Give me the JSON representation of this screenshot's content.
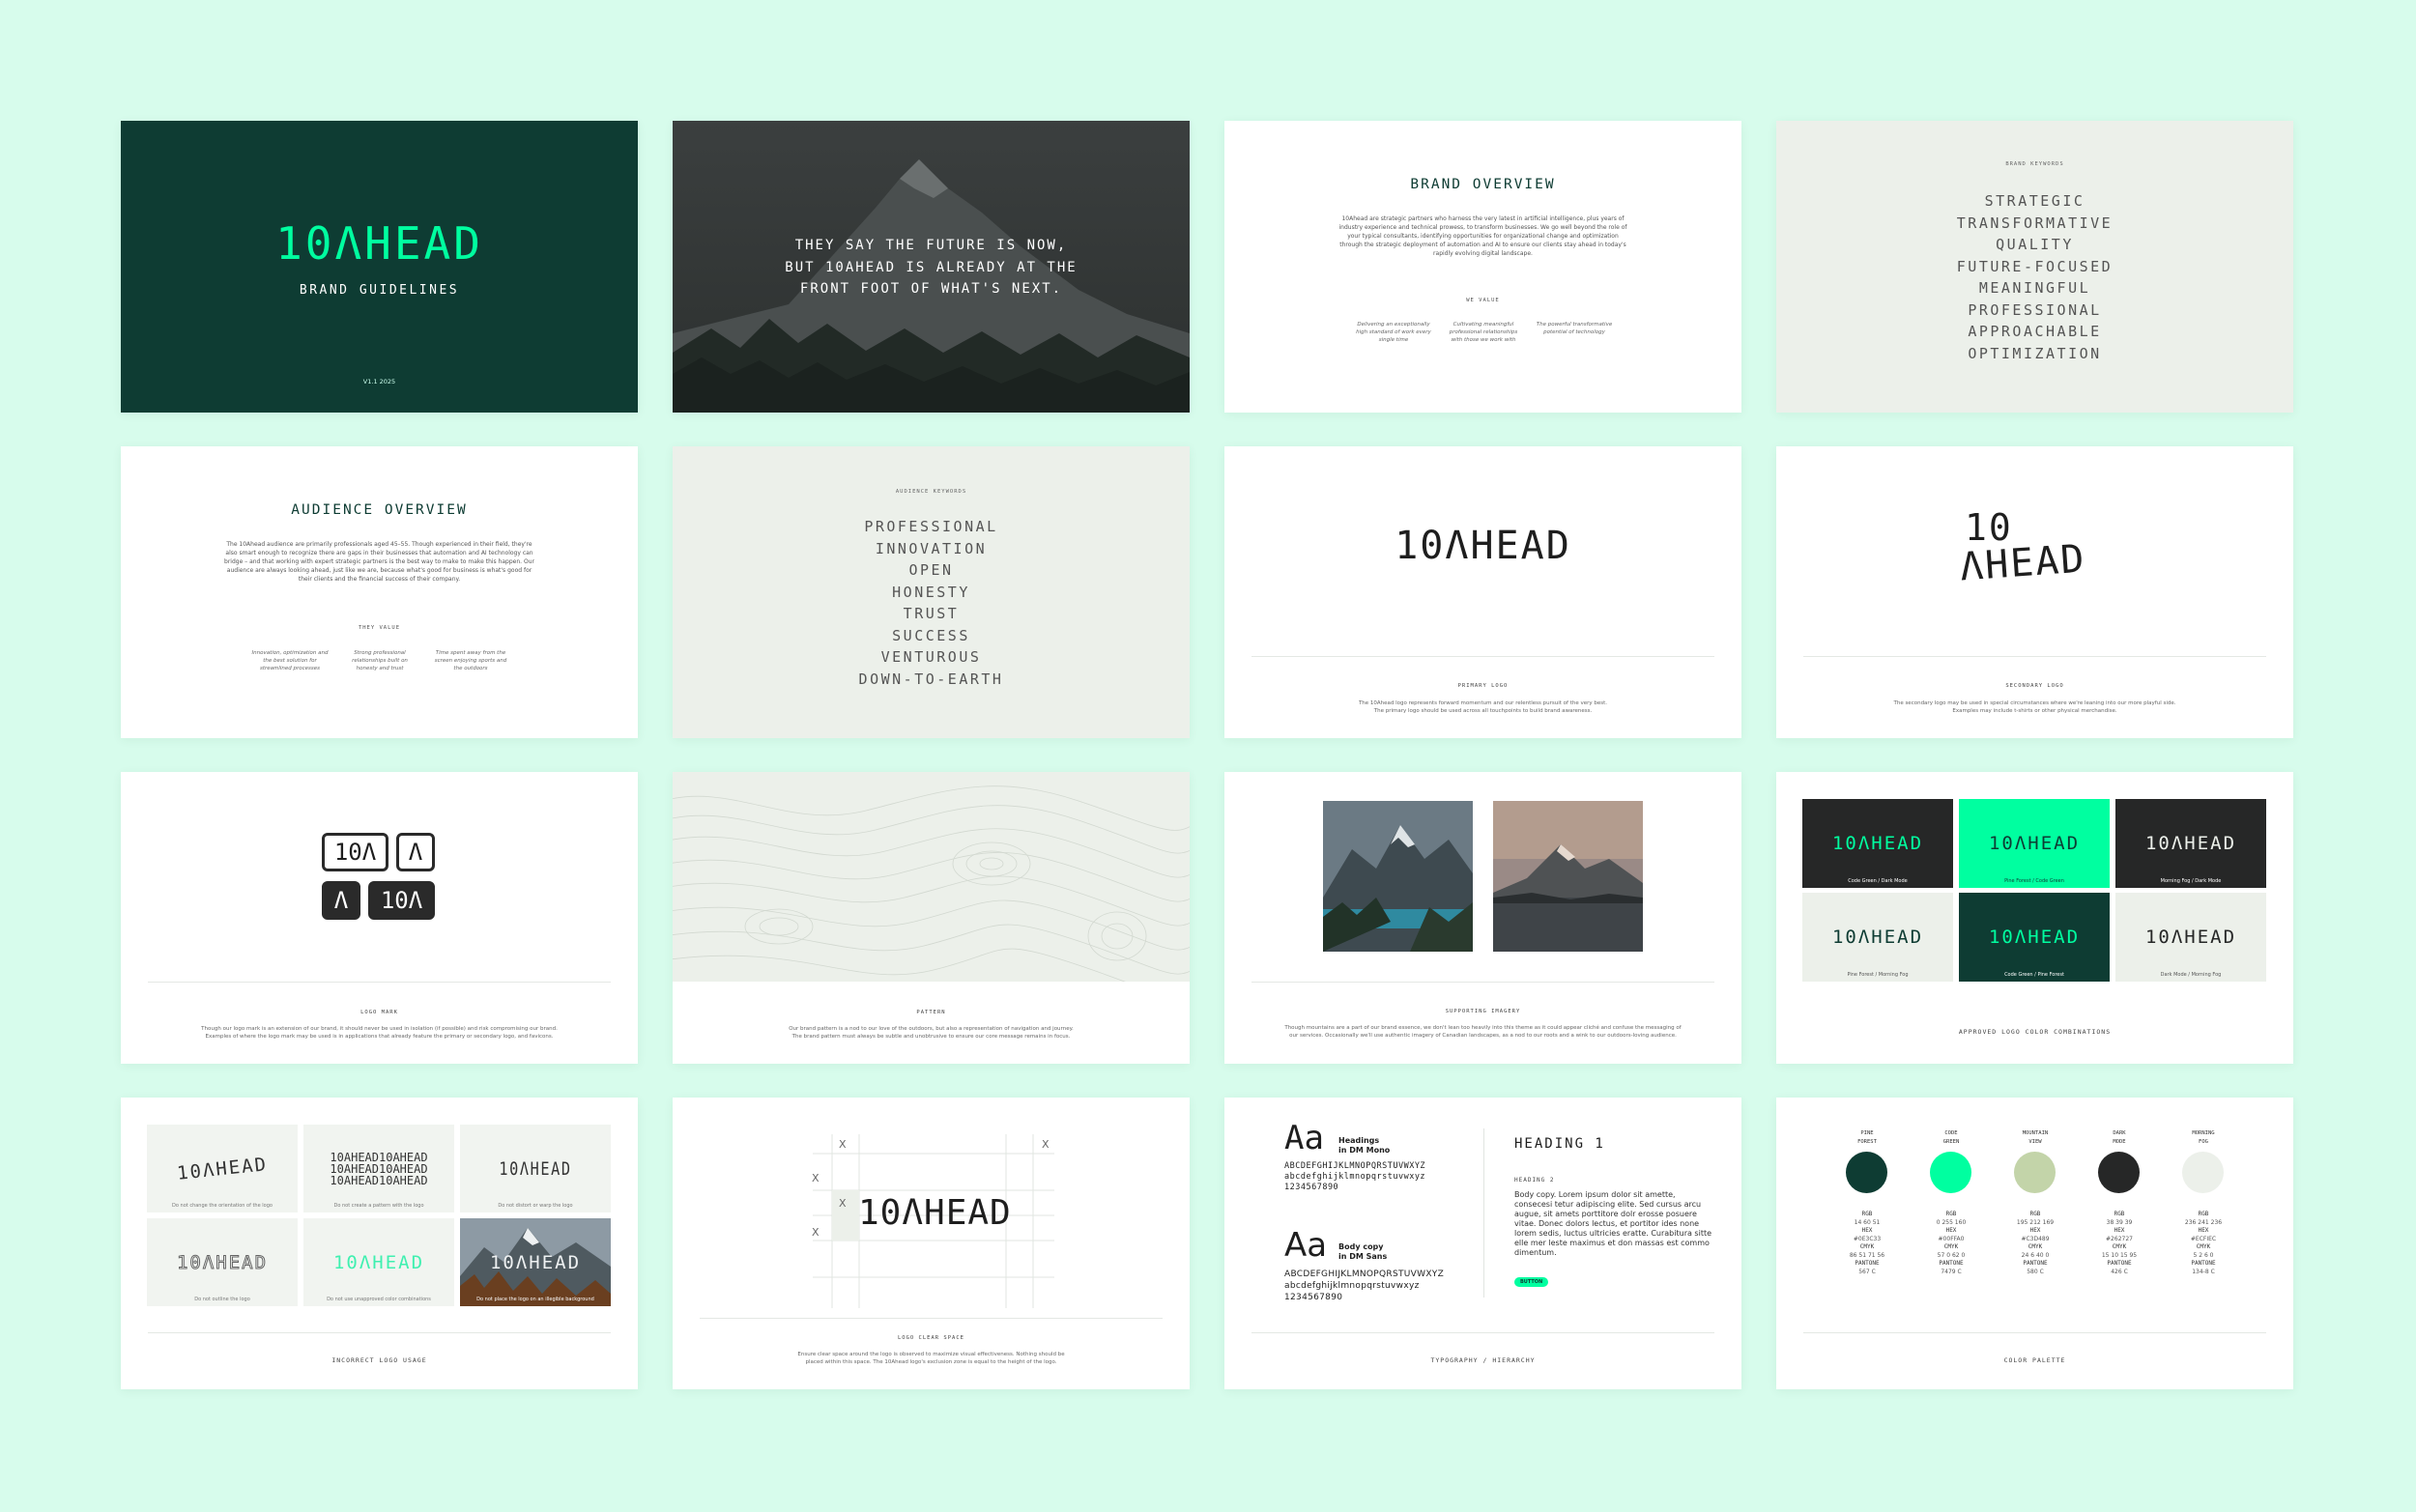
{
  "brand": {
    "logo": "10ΛHEAD",
    "logo_split_top": "10",
    "logo_split_bottom": "ΛHEAD"
  },
  "colors": {
    "page_bg": "#d7fcec",
    "pine_forest": "#0E3C33",
    "code_green": "#00FFA0",
    "mountain_view": "#C3D489",
    "dark_mode": "#262727",
    "morning_fog": "#ECF0EA"
  },
  "slides": {
    "cover": {
      "title": "BRAND GUIDELINES",
      "version": "V1.1 2025"
    },
    "quote": {
      "lines": [
        "THEY SAY THE FUTURE IS NOW,",
        "BUT 10AHEAD IS ALREADY AT THE",
        "FRONT FOOT OF WHAT'S NEXT."
      ]
    },
    "brand_overview": {
      "title": "BRAND OVERVIEW",
      "body": "10Ahead are strategic partners who harness the very latest in artificial intelligence, plus years of industry experience and technical prowess, to transform businesses. We go well beyond the role of your typical consultants, identifying opportunities for organizational change and optimization through the strategic deployment of automation and AI to ensure our clients stay ahead in today's rapidly evolving digital landscape.",
      "values_label": "WE VALUE",
      "values": [
        "Delivering an exceptionally high standard of work every single time",
        "Cultivating meaningful professional relationships with those we work with",
        "The powerful transformative potential of technology"
      ]
    },
    "brand_keywords": {
      "label": "BRAND KEYWORDS",
      "words": [
        "STRATEGIC",
        "TRANSFORMATIVE",
        "QUALITY",
        "FUTURE-FOCUSED",
        "MEANINGFUL",
        "PROFESSIONAL",
        "APPROACHABLE",
        "OPTIMIZATION"
      ]
    },
    "audience_overview": {
      "title": "AUDIENCE OVERVIEW",
      "body": "The 10Ahead audience are primarily professionals aged 45–55. Though experienced in their field, they're also smart enough to recognize there are gaps in their businesses that automation and AI technology can bridge – and that working with expert strategic partners is the best way to make to make this happen. Our audience are always looking ahead, just like we are, because what's good for business is what's good for their clients and the financial success of their company.",
      "values_label": "THEY VALUE",
      "values": [
        "Innovation, optimization and the best solution for streamlined processes",
        "Strong professional relationships built on honesty and trust",
        "Time spent away from the screen enjoying sports and the outdoors"
      ]
    },
    "audience_keywords": {
      "label": "AUDIENCE KEYWORDS",
      "words": [
        "PROFESSIONAL",
        "INNOVATION",
        "OPEN",
        "HONESTY",
        "TRUST",
        "SUCCESS",
        "VENTUROUS",
        "DOWN-TO-EARTH"
      ]
    },
    "primary_logo": {
      "caption": "PRIMARY LOGO",
      "desc": [
        "The 10Ahead logo represents forward momentum and our relentless pursuit of the very best.",
        "The primary logo should be used across all touchpoints to build brand awareness."
      ]
    },
    "secondary_logo": {
      "caption": "SECONDARY LOGO",
      "desc": [
        "The secondary logo may be used in special circumstances where we're leaning into our more playful side.",
        "Examples may include t-shirts or other physical merchandise."
      ]
    },
    "logo_mark": {
      "caption": "LOGO MARK",
      "marks": [
        "10Λ",
        "Λ",
        "Λ",
        "10Λ"
      ],
      "desc": [
        "Though our logo mark is an extension of our brand, it should never be used in isolation (if possible) and risk compromising our brand.",
        "Examples of where the logo mark may be used is in applications that already feature the primary or secondary logo, and favicons."
      ]
    },
    "pattern": {
      "caption": "PATTERN",
      "desc": [
        "Our brand pattern is a nod to our love of the outdoors, but also a representation of navigation and journey.",
        "The brand pattern must always be subtle and unobtrusive to ensure our core message remains in focus."
      ]
    },
    "imagery": {
      "caption": "SUPPORTING IMAGERY",
      "desc": [
        "Though mountains are a part of our brand essence, we don't lean too heavily into this theme as it could appear cliché and confuse the messaging of",
        "our services. Occasionally we'll use authentic imagery of Canadian landscapes, as a nod to our roots and a wink to our outdoors-loving audience."
      ]
    },
    "color_combos": {
      "caption": "APPROVED LOGO COLOR COMBINATIONS",
      "tiles": [
        "Code Green / Dark Mode",
        "Pine Forest / Code Green",
        "Morning Fog / Dark Mode",
        "Pine Forest / Morning Fog",
        "Code Green / Pine Forest",
        "Dark Mode / Morning Fog"
      ]
    },
    "incorrect": {
      "caption": "INCORRECT LOGO USAGE",
      "tiles": [
        "Do not change the orientation of the logo",
        "Do not create a pattern with the logo",
        "Do not distort or warp the logo",
        "Do not outline the logo",
        "Do not use unapproved color combinations",
        "Do not place the logo on an illegible background"
      ],
      "pattern_text": "10AHEAD10AHEAD"
    },
    "clear_space": {
      "caption": "LOGO CLEAR SPACE",
      "mark": "X",
      "desc": [
        "Ensure clear space around the logo is observed to maximize visual effectiveness. Nothing should be",
        "placed within this space. The 10Ahead logo's exclusion zone is equal to the height of the logo."
      ]
    },
    "typography": {
      "caption": "TYPOGRAPHY / HIERARCHY",
      "aa": "Aa",
      "headings_label": "Headings",
      "headings_font": "in DM Mono",
      "body_label": "Body copy",
      "body_font": "in DM Sans",
      "upper": "ABCDEFGHIJKLMNOPQRSTUVWXYZ",
      "lower": "abcdefghijklmnopqrstuvwxyz",
      "digits": "1234567890",
      "h1": "HEADING 1",
      "h2": "HEADING 2",
      "body": "Body copy. Lorem ipsum dolor sit amette, consecesi tetur adipiscing elite. Sed cursus arcu augue, sit amets porttitore dolr erosse posuere vitae. Donec dolors lectus, et portitor ides none lorem sedis, luctus ultricies eratte. Curabitura sitte elle mer leste maximus et don massas est commo dimentum.",
      "button": "BUTTON"
    },
    "palette": {
      "caption": "COLOR PALETTE",
      "columns": [
        {
          "name1": "PINE",
          "name2": "FOREST",
          "color": "#0E3C33",
          "rgb": "14 60 51",
          "hex": "#0E3C33",
          "cmyk": "86 51 71 56",
          "pantone": "567 C"
        },
        {
          "name1": "CODE",
          "name2": "GREEN",
          "color": "#00FFA0",
          "rgb": "0 255 160",
          "hex": "#00FFA0",
          "cmyk": "57 0 62 0",
          "pantone": "7479 C"
        },
        {
          "name1": "MOUNTAIN",
          "name2": "VIEW",
          "color": "#C3D489",
          "rgb": "195 212 169",
          "hex": "#C3D489",
          "cmyk": "24 6 40 0",
          "pantone": "580 C"
        },
        {
          "name1": "DARK",
          "name2": "MODE",
          "color": "#262727",
          "rgb": "38 39 39",
          "hex": "#262727",
          "cmyk": "15 10 15 95",
          "pantone": "426 C"
        },
        {
          "name1": "MORNING",
          "name2": "FOG",
          "color": "#ECF0EA",
          "rgb": "236 241 236",
          "hex": "#ECFIEC",
          "cmyk": "5 2 6 0",
          "pantone": "134-8 C"
        }
      ],
      "labels": {
        "rgb": "RGB",
        "hex": "HEX",
        "cmyk": "CMYK",
        "pantone": "PANTONE"
      }
    }
  }
}
